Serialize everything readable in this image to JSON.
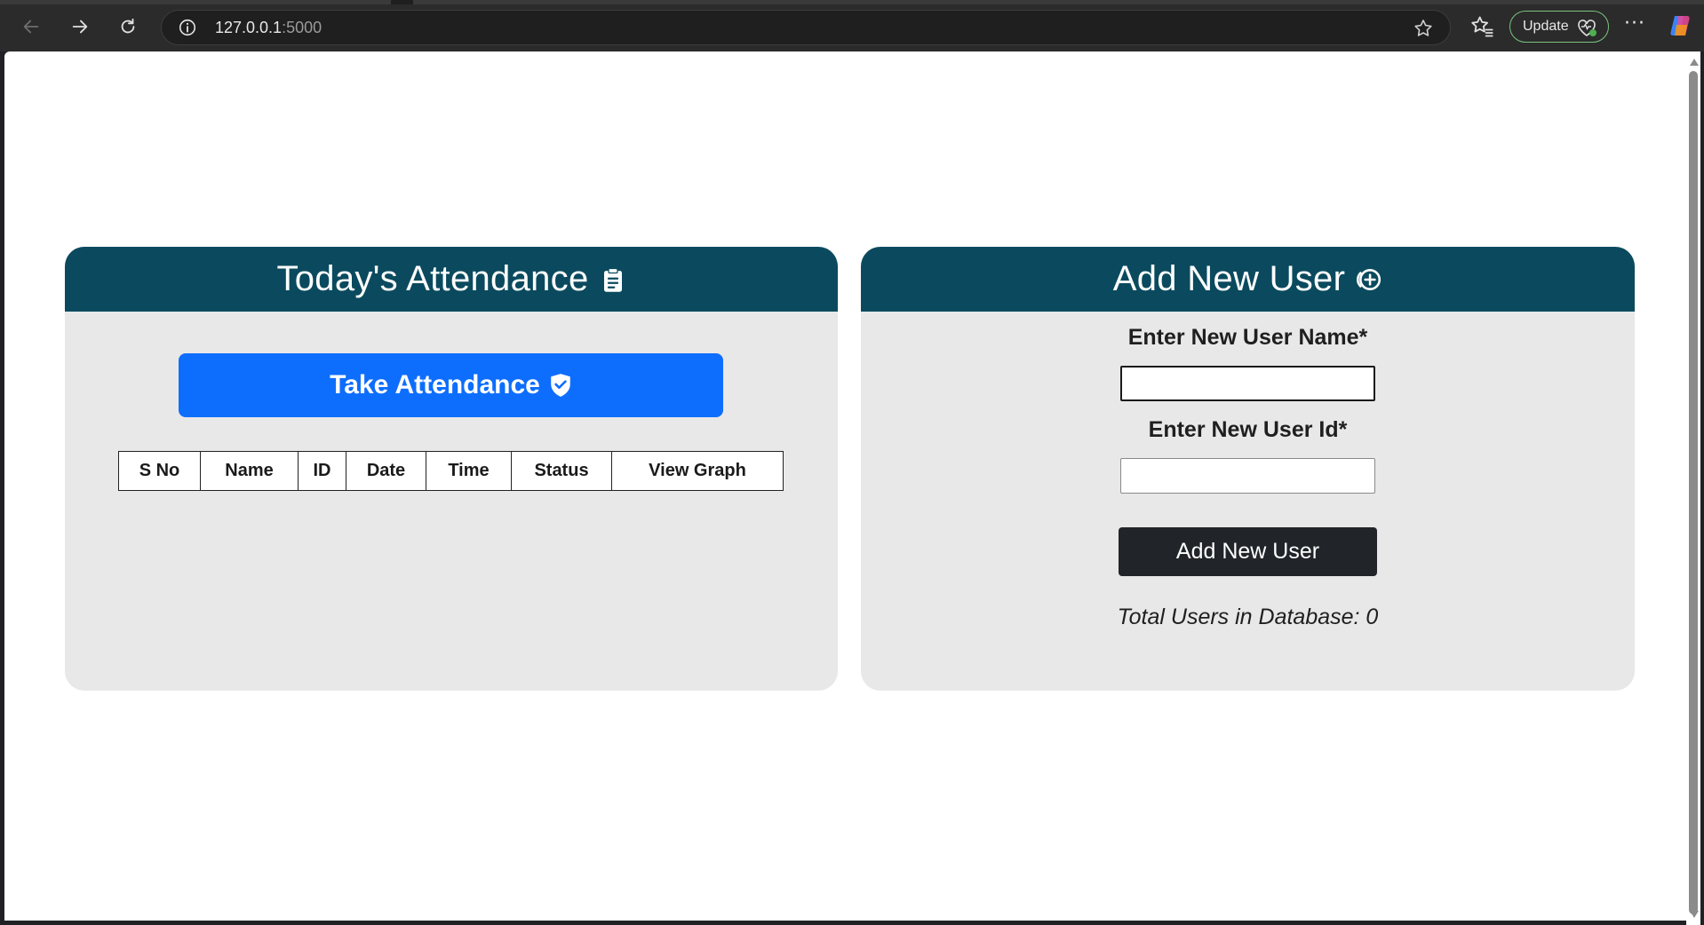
{
  "browser": {
    "url_host": "127.0.0.1",
    "url_port": ":5000",
    "update_label": "Update",
    "more_label": "···"
  },
  "attendance_card": {
    "title": "Today's Attendance",
    "take_button_label": "Take Attendance",
    "table": {
      "headers": [
        "S No",
        "Name",
        "ID",
        "Date",
        "Time",
        "Status",
        "View Graph"
      ],
      "rows": []
    }
  },
  "add_user_card": {
    "title": "Add New User",
    "name_label": "Enter New User Name*",
    "name_value": "",
    "id_label": "Enter New User Id*",
    "id_value": "",
    "submit_label": "Add New User",
    "total_users_text": "Total Users in Database: 0"
  },
  "colors": {
    "header_bg": "#0b4a5e",
    "card_bg": "#e8e8e8",
    "primary_button": "#0d6efd",
    "dark_button": "#212529"
  }
}
